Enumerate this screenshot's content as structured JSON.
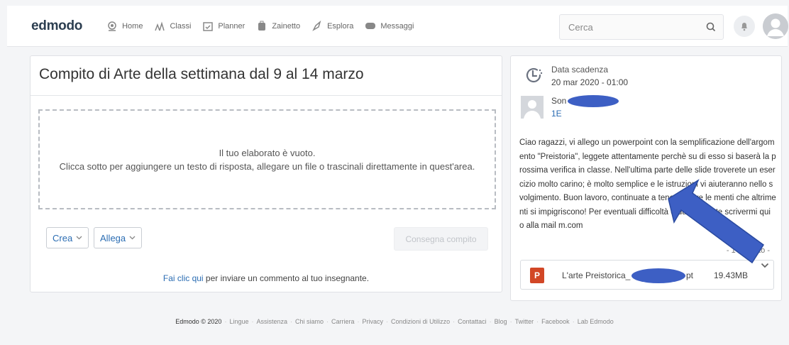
{
  "navbar": {
    "logo": "edmodo",
    "items": [
      {
        "label": "Home",
        "icon": "home-icon"
      },
      {
        "label": "Classi",
        "icon": "classes-icon"
      },
      {
        "label": "Planner",
        "icon": "planner-icon"
      },
      {
        "label": "Zainetto",
        "icon": "backpack-icon"
      },
      {
        "label": "Esplora",
        "icon": "rocket-icon"
      },
      {
        "label": "Messaggi",
        "icon": "message-icon"
      }
    ],
    "search_placeholder": "Cerca"
  },
  "assignment": {
    "title": "Compito di Arte della settimana dal 9 al 14 marzo",
    "empty_line1": "Il tuo elaborato è vuoto.",
    "empty_line2": "Clicca sotto per aggiungere un testo di risposta, allegare un file o trascinali direttamente in quest'area.",
    "create_label": "Crea",
    "attach_label": "Allega",
    "submit_label": "Consegna compito",
    "comment_link_strong": "Fai clic qui",
    "comment_link_rest": " per inviare un commento al tuo insegnante."
  },
  "details": {
    "due_label": "Data scadenza",
    "due_date": "20 mar 2020 - 01:00",
    "teacher_name": "Son",
    "class_name": "1E",
    "description": "Ciao ragazzi, vi allego un powerpoint con la semplificazione dell'argomento \"Preistoria\", leggete attentamente perchè su di esso si baserà la prossima verifica in classe. Nell'ultima parte delle slide troverete un esercizio molto carino; è molto semplice e le istruzioni vi aiuteranno nello svolgimento. Buon lavoro, continuate a tenere attive le menti che altrimenti si impigriscono! Per eventuali difficoltà o dubbi potete scrivermi qui o alla mail m.com",
    "attach_count": "- 1 allegato -",
    "file_name": "L'arte Preistorica_",
    "file_ext": "pt",
    "file_size": "19.43MB"
  },
  "footer": {
    "brand": "Edmodo © 2020",
    "links": [
      "Lingue",
      "Assistenza",
      "Chi siamo",
      "Carriera",
      "Privacy",
      "Condizioni di Utilizzo",
      "Contattaci",
      "Blog",
      "Twitter",
      "Facebook",
      "Lab Edmodo"
    ]
  },
  "colors": {
    "link": "#2b6db3",
    "powerpoint": "#d24726",
    "annotation_arrow": "#3d5fc4"
  }
}
